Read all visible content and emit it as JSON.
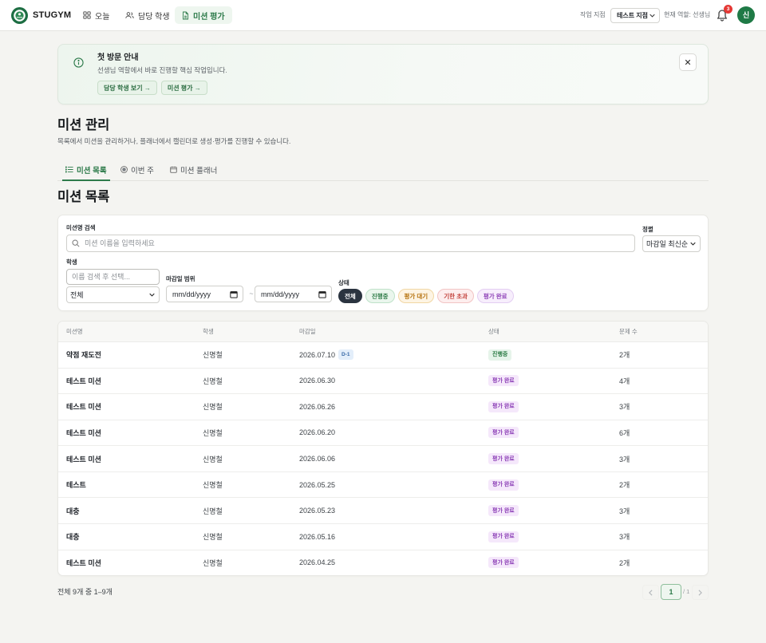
{
  "nav": {
    "brand": "STUGYM",
    "items": [
      {
        "label": "오늘",
        "icon": "grid-icon"
      },
      {
        "label": "담당 학생",
        "icon": "users-icon"
      },
      {
        "label": "미션 평가",
        "icon": "document-icon",
        "active": true
      }
    ],
    "branch_label": "작업 지점",
    "branch_value": "테스트 지점",
    "role_text": "현재 역할: 선생님",
    "notification_count": "3",
    "avatar_initial": "신"
  },
  "banner": {
    "icon": "info-icon",
    "title": "첫 방문 안내",
    "description": "선생님 역할에서 바로 진행할 핵심 작업입니다.",
    "actions": [
      {
        "label": "담당 학생 보기 →"
      },
      {
        "label": "미션 평가 →"
      }
    ]
  },
  "page": {
    "title": "미션 관리",
    "subtitle": "목록에서 미션을 관리하거나, 플래너에서 캘린더로 생성·평가를 진행할 수 있습니다."
  },
  "tabs": [
    {
      "label": "미션 목록",
      "icon": "list-icon",
      "active": true
    },
    {
      "label": "이번 주",
      "icon": "target-icon"
    },
    {
      "label": "미션 플래너",
      "icon": "calendar-icon"
    }
  ],
  "section_title": "미션 목록",
  "filters": {
    "search": {
      "label": "미션명 검색",
      "placeholder": "미션 이름을 입력하세요"
    },
    "sort": {
      "label": "정렬",
      "value": "마감일 최신순"
    },
    "student": {
      "label": "학생",
      "placeholder": "이름 검색 후 선택...",
      "value": "전체"
    },
    "date_range": {
      "label": "마감일 범위",
      "from_placeholder": "mm/dd/yyyy",
      "to_placeholder": "mm/dd/yyyy",
      "separator": "~"
    },
    "status": {
      "label": "상태",
      "chips": [
        {
          "label": "전체",
          "active": true,
          "bg": "#2b3440",
          "border": "#2b3440",
          "fg": "#ffffff"
        },
        {
          "label": "진행중",
          "bg": "#eaf6ed",
          "border": "#bfe2c9",
          "fg": "#2e7b47"
        },
        {
          "label": "평가 대기",
          "bg": "#fdf4e3",
          "border": "#f1d7a4",
          "fg": "#b5700a"
        },
        {
          "label": "기한 초과",
          "bg": "#fdeeee",
          "border": "#f2c4c4",
          "fg": "#c2403a"
        },
        {
          "label": "평가 완료",
          "bg": "#f7eefc",
          "border": "#e3cdf2",
          "fg": "#8c3fb6"
        }
      ]
    }
  },
  "table": {
    "columns": [
      "미션명",
      "학생",
      "마감일",
      "상태",
      "문제 수"
    ],
    "rows": [
      {
        "name": "약점 재도전",
        "student": "신명철",
        "due": "2026.07.10",
        "due_badge": "D-1",
        "status": "진행중",
        "count": "2개"
      },
      {
        "name": "테스트 미션",
        "student": "신명철",
        "due": "2026.06.30",
        "status": "평가 완료",
        "count": "4개"
      },
      {
        "name": "테스트 미션",
        "student": "신명철",
        "due": "2026.06.26",
        "status": "평가 완료",
        "count": "3개"
      },
      {
        "name": "테스트 미션",
        "student": "신명철",
        "due": "2026.06.20",
        "status": "평가 완료",
        "count": "6개"
      },
      {
        "name": "테스트 미션",
        "student": "신명철",
        "due": "2026.06.06",
        "status": "평가 완료",
        "count": "3개"
      },
      {
        "name": "테스트",
        "student": "신명철",
        "due": "2026.05.25",
        "status": "평가 완료",
        "count": "2개"
      },
      {
        "name": "대충",
        "student": "신명철",
        "due": "2026.05.23",
        "status": "평가 완료",
        "count": "3개"
      },
      {
        "name": "대충",
        "student": "신명철",
        "due": "2026.05.16",
        "status": "평가 완료",
        "count": "3개"
      },
      {
        "name": "테스트 미션",
        "student": "신명철",
        "due": "2026.04.25",
        "status": "평가 완료",
        "count": "2개"
      }
    ],
    "status_colors": {
      "진행중": {
        "bg": "#e6f4ea",
        "fg": "#2d7c46"
      },
      "평가 완료": {
        "bg": "#f5e8fb",
        "fg": "#8c3fb6"
      }
    }
  },
  "footer": {
    "summary": "전체 9개 중 1–9개",
    "current_page": "1",
    "total_pages": "/ 1"
  }
}
